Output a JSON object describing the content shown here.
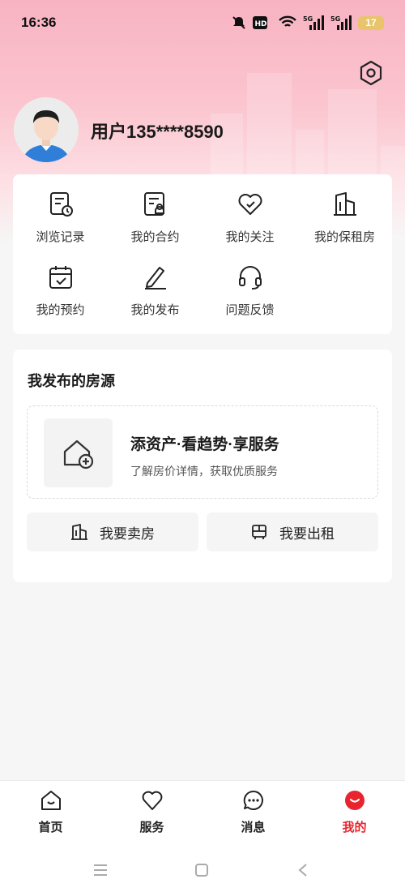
{
  "status_bar": {
    "time": "16:36",
    "battery": "17",
    "network_label": "5G"
  },
  "profile": {
    "username": "用户135****8590"
  },
  "quick_links": [
    {
      "label": "浏览记录",
      "icon": "history-icon"
    },
    {
      "label": "我的合约",
      "icon": "contract-icon"
    },
    {
      "label": "我的关注",
      "icon": "heart-check-icon"
    },
    {
      "label": "我的保租房",
      "icon": "building-icon"
    },
    {
      "label": "我的预约",
      "icon": "calendar-check-icon"
    },
    {
      "label": "我的发布",
      "icon": "edit-icon"
    },
    {
      "label": "问题反馈",
      "icon": "headset-icon"
    }
  ],
  "listings": {
    "title": "我发布的房源",
    "add_title": "添资产·看趋势·享服务",
    "add_subtitle": "了解房价详情，获取优质服务",
    "sell_label": "我要卖房",
    "rent_label": "我要出租"
  },
  "tabs": [
    {
      "label": "首页",
      "icon": "home-icon",
      "active": false
    },
    {
      "label": "服务",
      "icon": "heart-icon",
      "active": false
    },
    {
      "label": "消息",
      "icon": "message-icon",
      "active": false
    },
    {
      "label": "我的",
      "icon": "profile-icon",
      "active": true
    }
  ],
  "colors": {
    "accent": "#e8242f",
    "hero_pink": "#f8b3c2"
  }
}
